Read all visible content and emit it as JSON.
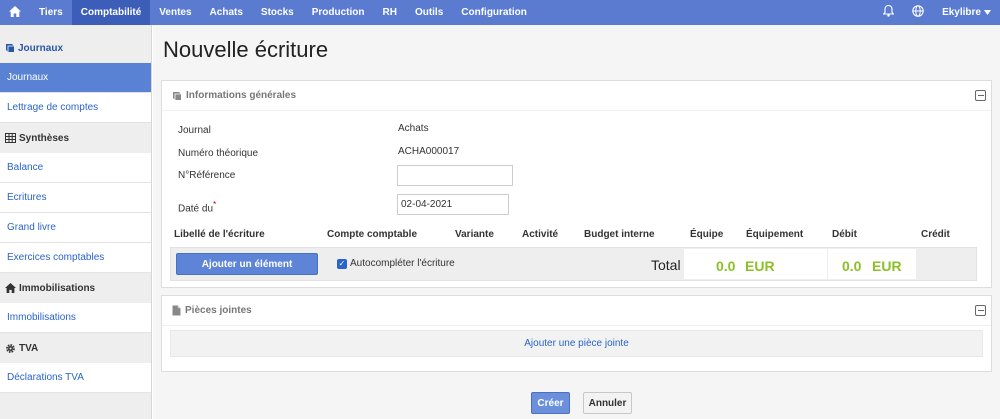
{
  "topnav": {
    "home_icon": "home-icon",
    "items": [
      {
        "label": "Tiers",
        "active": false
      },
      {
        "label": "Comptabilité",
        "active": true
      },
      {
        "label": "Ventes",
        "active": false
      },
      {
        "label": "Achats",
        "active": false
      },
      {
        "label": "Stocks",
        "active": false
      },
      {
        "label": "Production",
        "active": false
      },
      {
        "label": "RH",
        "active": false
      },
      {
        "label": "Outils",
        "active": false
      },
      {
        "label": "Configuration",
        "active": false
      }
    ],
    "notifications_icon": "bell-icon",
    "language_icon": "globe-icon",
    "user_label": "Ekylibre",
    "user_menu_icon": "chevron-down-icon",
    "bar_color": "#5a7bd0",
    "active_color": "#3c5eb8"
  },
  "sidebar": {
    "sections": [
      {
        "title": "Journaux",
        "icon": "book-icon",
        "items": [
          {
            "label": "Journaux",
            "active": true
          },
          {
            "label": "Lettrage de comptes",
            "active": false
          }
        ]
      },
      {
        "title": "Synthèses",
        "icon": "table-icon",
        "items": [
          {
            "label": "Balance",
            "active": false
          },
          {
            "label": "Ecritures",
            "active": false
          },
          {
            "label": "Grand livre",
            "active": false
          },
          {
            "label": "Exercices comptables",
            "active": false
          }
        ]
      },
      {
        "title": "Immobilisations",
        "icon": "home-icon",
        "items": [
          {
            "label": "Immobilisations",
            "active": false
          }
        ]
      },
      {
        "title": "TVA",
        "icon": "gear-icon",
        "items": [
          {
            "label": "Déclarations TVA",
            "active": false
          }
        ]
      }
    ]
  },
  "page": {
    "title": "Nouvelle écriture"
  },
  "general": {
    "title": "Informations générales",
    "icon": "book-icon",
    "fields": {
      "journal_label": "Journal",
      "journal_value": "Achats",
      "numero_label": "Numéro théorique",
      "numero_value": "ACHA000017",
      "reference_label": "N°Référence",
      "reference_value": "",
      "date_label": "Daté du",
      "date_required": "*",
      "date_value": "02-04-2021"
    },
    "grid": {
      "columns": [
        "Libellé de l'écriture",
        "Compte comptable",
        "Variante",
        "Activité",
        "Budget interne",
        "Équipe",
        "Équipement",
        "Débit",
        "Crédit"
      ],
      "add_button": "Ajouter un élément",
      "autocomplete_label": "Autocompléter l'écriture",
      "autocomplete_checked": true,
      "total_label": "Total",
      "debit_amount": "0.0",
      "debit_currency": "EUR",
      "credit_amount": "0.0",
      "credit_currency": "EUR",
      "amount_color": "#8cbf26"
    }
  },
  "attachments": {
    "title": "Pièces jointes",
    "icon": "file-icon",
    "add_link": "Ajouter une pièce jointe"
  },
  "actions": {
    "create": "Créer",
    "cancel": "Annuler"
  }
}
